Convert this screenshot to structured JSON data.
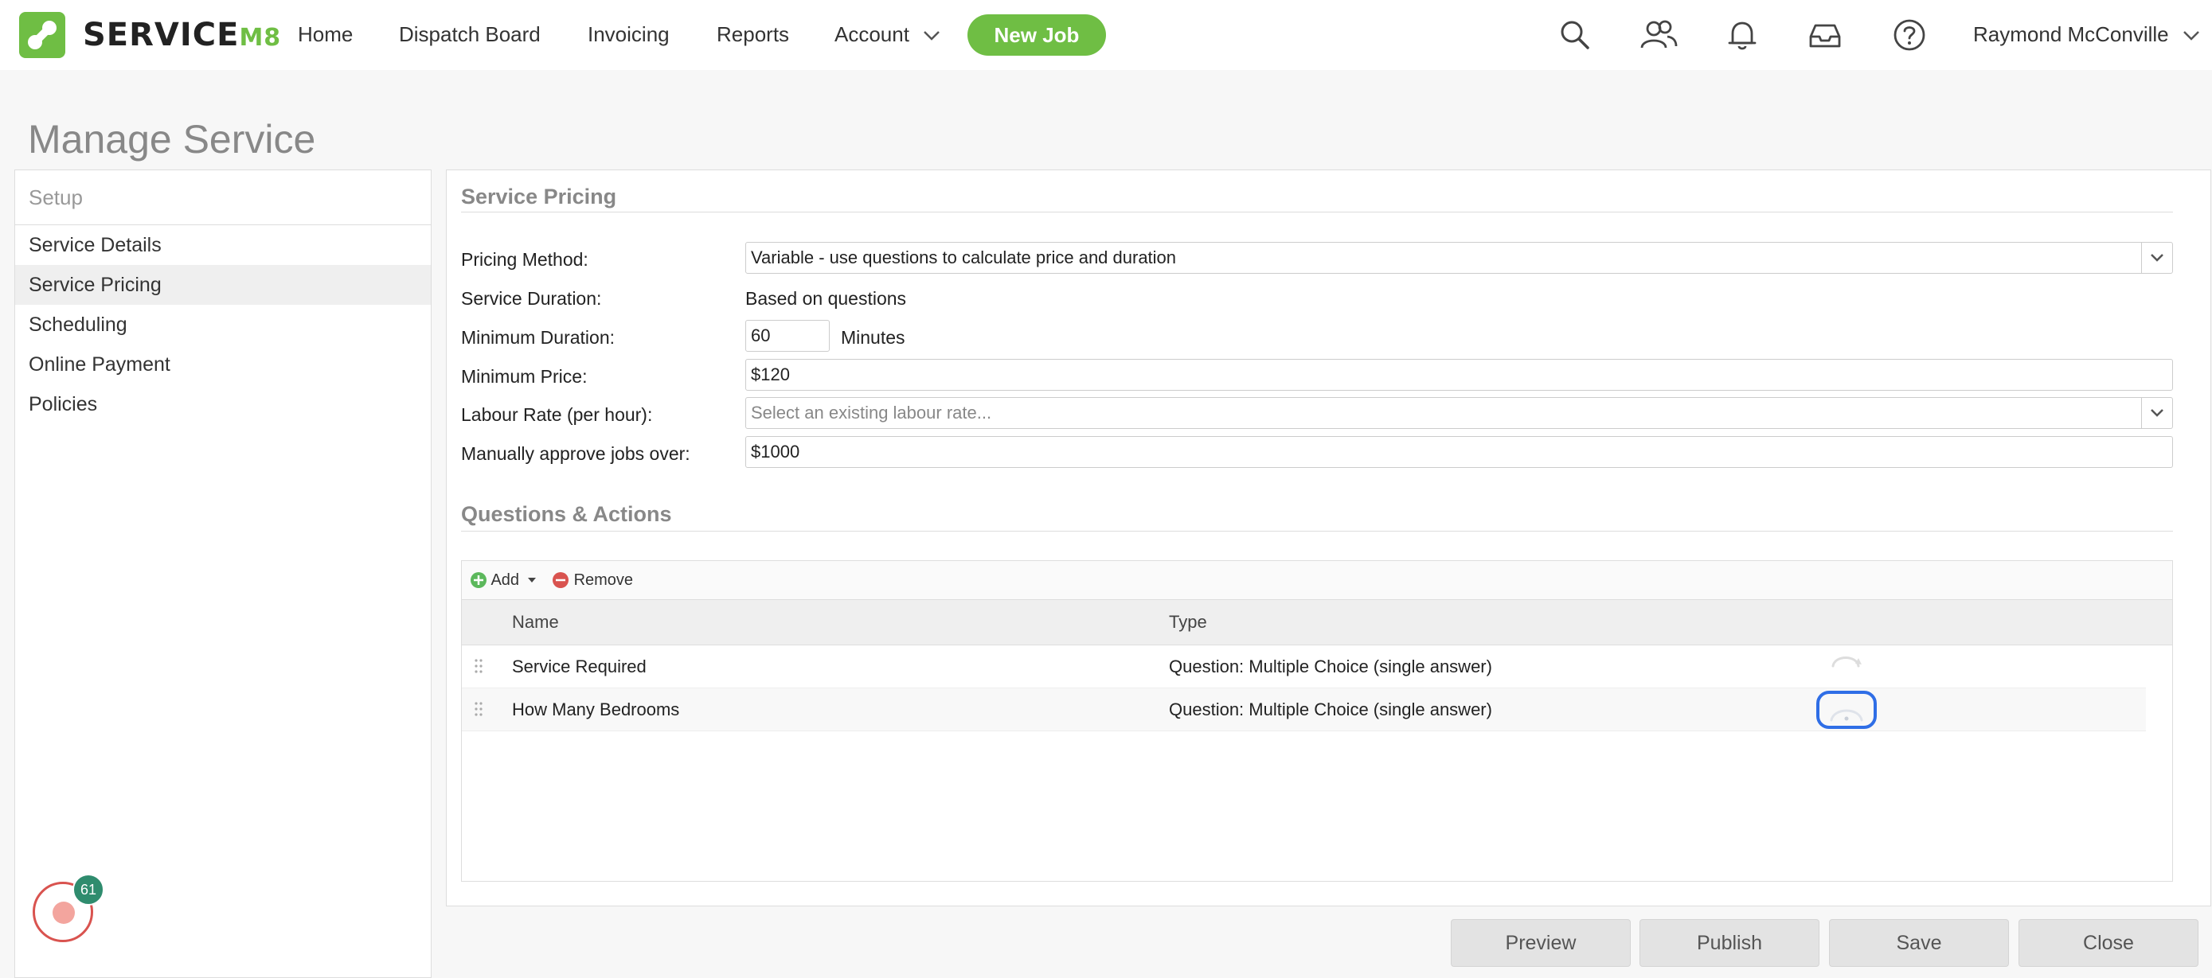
{
  "brand": {
    "name_main": "SERVICE",
    "name_suffix": "M8",
    "accent": "#6fbe44"
  },
  "nav": {
    "items": [
      {
        "label": "Home"
      },
      {
        "label": "Dispatch Board"
      },
      {
        "label": "Invoicing"
      },
      {
        "label": "Reports"
      },
      {
        "label": "Account"
      }
    ],
    "new_job": "New Job",
    "icons": [
      "search-icon",
      "people-icon",
      "bell-icon",
      "inbox-icon",
      "help-icon"
    ],
    "user": "Raymond McConville"
  },
  "page": {
    "title": "Manage Service"
  },
  "sidebar": {
    "header": "Setup",
    "items": [
      {
        "label": "Service Details"
      },
      {
        "label": "Service Pricing"
      },
      {
        "label": "Scheduling"
      },
      {
        "label": "Online Payment"
      },
      {
        "label": "Policies"
      }
    ],
    "help_badge": "61"
  },
  "pricing": {
    "section_title": "Service Pricing",
    "pricing_method_label": "Pricing Method:",
    "pricing_method_value": "Variable - use questions to calculate price and duration",
    "service_duration_label": "Service Duration:",
    "service_duration_value": "Based on questions",
    "min_duration_label": "Minimum Duration:",
    "min_duration_value": "60",
    "min_duration_unit": "Minutes",
    "min_price_label": "Minimum Price:",
    "min_price_value": "$120",
    "labour_rate_label": "Labour Rate (per hour):",
    "labour_rate_placeholder": "Select an existing labour rate...",
    "approve_label": "Manually approve jobs over:",
    "approve_value": "$1000"
  },
  "questions": {
    "section_title": "Questions & Actions",
    "add_label": "Add",
    "remove_label": "Remove",
    "columns": [
      "Name",
      "Type"
    ],
    "rows": [
      {
        "name": "Service Required",
        "type": "Question: Multiple Choice (single answer)"
      },
      {
        "name": "How Many Bedrooms",
        "type": "Question: Multiple Choice (single answer)"
      }
    ]
  },
  "footer": {
    "preview": "Preview",
    "publish": "Publish",
    "save": "Save",
    "close": "Close"
  }
}
